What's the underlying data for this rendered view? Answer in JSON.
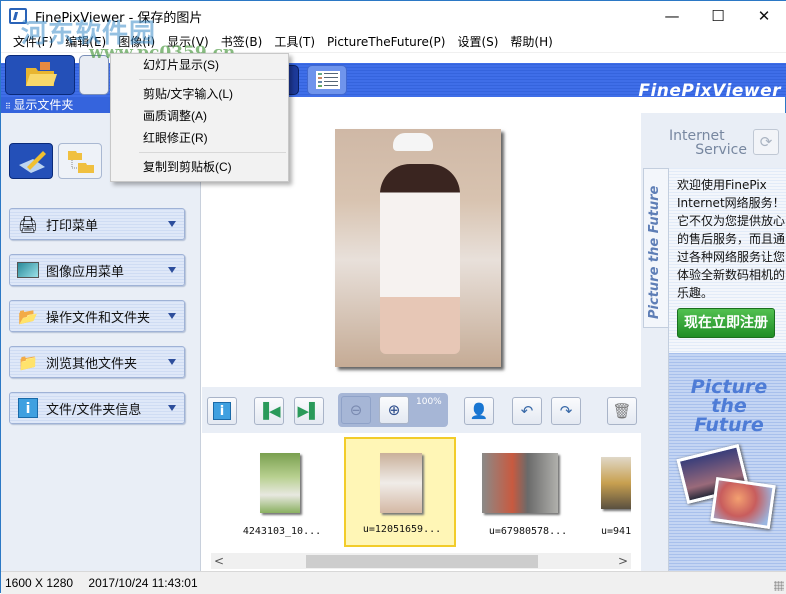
{
  "window": {
    "title": "FinePixViewer  - 保存的图片",
    "controls": {
      "minimize": "—",
      "maximize": "☐",
      "close": "✕"
    }
  },
  "watermark": {
    "main": "河东软件园",
    "url": "www.pc0359.cn"
  },
  "menubar": {
    "items": [
      "文件(F)",
      "编辑(E)",
      "图像(I)",
      "显示(V)",
      "书签(B)",
      "工具(T)",
      "PictureTheFuture(P)",
      "设置(S)",
      "帮助(H)"
    ]
  },
  "dropdown": {
    "parent": "图像(I)",
    "items": [
      {
        "label": "幻灯片显示(S)"
      },
      {
        "separator": true
      },
      {
        "label": "剪贴/文字输入(L)"
      },
      {
        "label": "画质调整(A)"
      },
      {
        "label": "红眼修正(R)"
      },
      {
        "separator": true
      },
      {
        "label": "复制到剪贴板(C)"
      }
    ]
  },
  "toolbar": {
    "brand": "FinePixViewer",
    "buttons": [
      "folder-view",
      "calendar-view",
      "image-view",
      "list-view"
    ]
  },
  "left_panel": {
    "header": "显示文件夹",
    "view_buttons": [
      "edit-mode",
      "folder-tree"
    ],
    "menus": [
      {
        "label": "打印菜单",
        "icon": "printer-icon"
      },
      {
        "label": "图像应用菜单",
        "icon": "image-icon"
      },
      {
        "label": "操作文件和文件夹",
        "icon": "folder-edit-icon"
      },
      {
        "label": "浏览其他文件夹",
        "icon": "folder-icon"
      },
      {
        "label": "文件/文件夹信息",
        "icon": "info-icon"
      }
    ]
  },
  "viewer": {
    "controls": {
      "info": "i",
      "first": "⏮",
      "last": "⏭",
      "zoom_out": "−",
      "zoom_in": "+",
      "zoom_level": "100%",
      "face": "face",
      "rotate_left": "↶",
      "rotate_right": "↷",
      "delete": "🗑"
    }
  },
  "thumbnails": [
    {
      "caption": "4243103_10...",
      "selected": false
    },
    {
      "caption": "u=12051659...",
      "selected": true
    },
    {
      "caption": "u=67980578...",
      "selected": false
    },
    {
      "caption": "u=941",
      "selected": false
    }
  ],
  "scrollbar": {
    "left": "<",
    "right": ">"
  },
  "right_panel": {
    "title_line1": "Internet",
    "title_line2": "Service",
    "refresh_icon": "⟳",
    "vertical_tab": "Picture the Future",
    "promo_text": "欢迎使用FinePix Internet网络服务！它不仅为您提供放心的售后服务，而且通过各种网络服务让您体验全新数码相机的乐趣。",
    "register_button": "现在立即注册",
    "logo_line1": "Picture",
    "logo_line2": "the Future"
  },
  "statusbar": {
    "dimensions": "1600 X 1280",
    "datetime": "2017/10/24 11:43:01"
  }
}
